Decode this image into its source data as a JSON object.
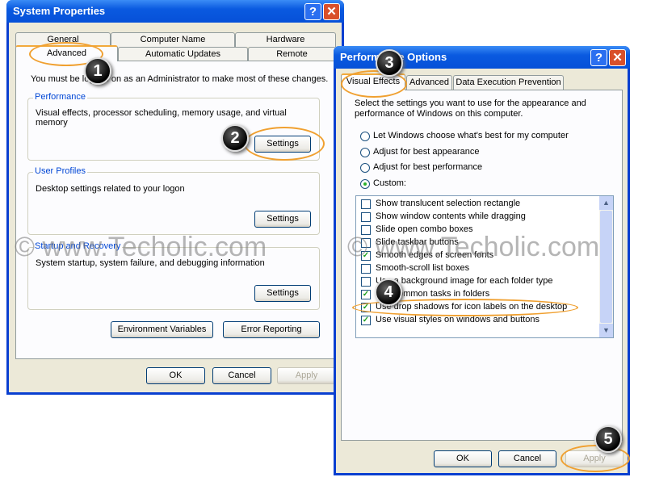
{
  "system_properties": {
    "title": "System Properties",
    "tabs_row1": [
      "General",
      "Computer Name",
      "Hardware"
    ],
    "tabs_row2": [
      "Advanced",
      "Automatic Updates",
      "Remote"
    ],
    "notice": "You must be logged on as an Administrator to make most of these changes.",
    "performance": {
      "label": "Performance",
      "desc": "Visual effects, processor scheduling, memory usage, and virtual memory",
      "button": "Settings"
    },
    "user_profiles": {
      "label": "User Profiles",
      "desc": "Desktop settings related to your logon",
      "button": "Settings"
    },
    "startup": {
      "label": "Startup and Recovery",
      "desc": "System startup, system failure, and debugging information",
      "button": "Settings"
    },
    "env_button": "Environment Variables",
    "error_button": "Error Reporting",
    "ok": "OK",
    "cancel": "Cancel",
    "apply": "Apply"
  },
  "performance_options": {
    "title": "Performance Options",
    "tabs": [
      "Visual Effects",
      "Advanced",
      "Data Execution Prevention"
    ],
    "intro": "Select the settings you want to use for the appearance and performance of Windows on this computer.",
    "radios": [
      {
        "label": "Let Windows choose what's best for my computer",
        "selected": false
      },
      {
        "label": "Adjust for best appearance",
        "selected": false
      },
      {
        "label": "Adjust for best performance",
        "selected": false
      },
      {
        "label": "Custom:",
        "selected": true
      }
    ],
    "options": [
      {
        "label": "Show translucent selection rectangle",
        "checked": false
      },
      {
        "label": "Show window contents while dragging",
        "checked": false
      },
      {
        "label": "Slide open combo boxes",
        "checked": false
      },
      {
        "label": "Slide taskbar buttons",
        "checked": false
      },
      {
        "label": "Smooth edges of screen fonts",
        "checked": true
      },
      {
        "label": "Smooth-scroll list boxes",
        "checked": false
      },
      {
        "label": "Use a background image for each folder type",
        "checked": false
      },
      {
        "label": "Use common tasks in folders",
        "checked": true
      },
      {
        "label": "Use drop shadows for icon labels on the desktop",
        "checked": true
      },
      {
        "label": "Use visual styles on windows and buttons",
        "checked": true
      }
    ],
    "ok": "OK",
    "cancel": "Cancel",
    "apply": "Apply"
  },
  "callouts": [
    "1",
    "2",
    "3",
    "4",
    "5"
  ],
  "watermark": "© www.Techolic.com",
  "title_buttons": {
    "help": "?",
    "close": "✕"
  },
  "accent_colors": {
    "title_bar": "#0a5ae0",
    "highlight": "#f0a030"
  }
}
